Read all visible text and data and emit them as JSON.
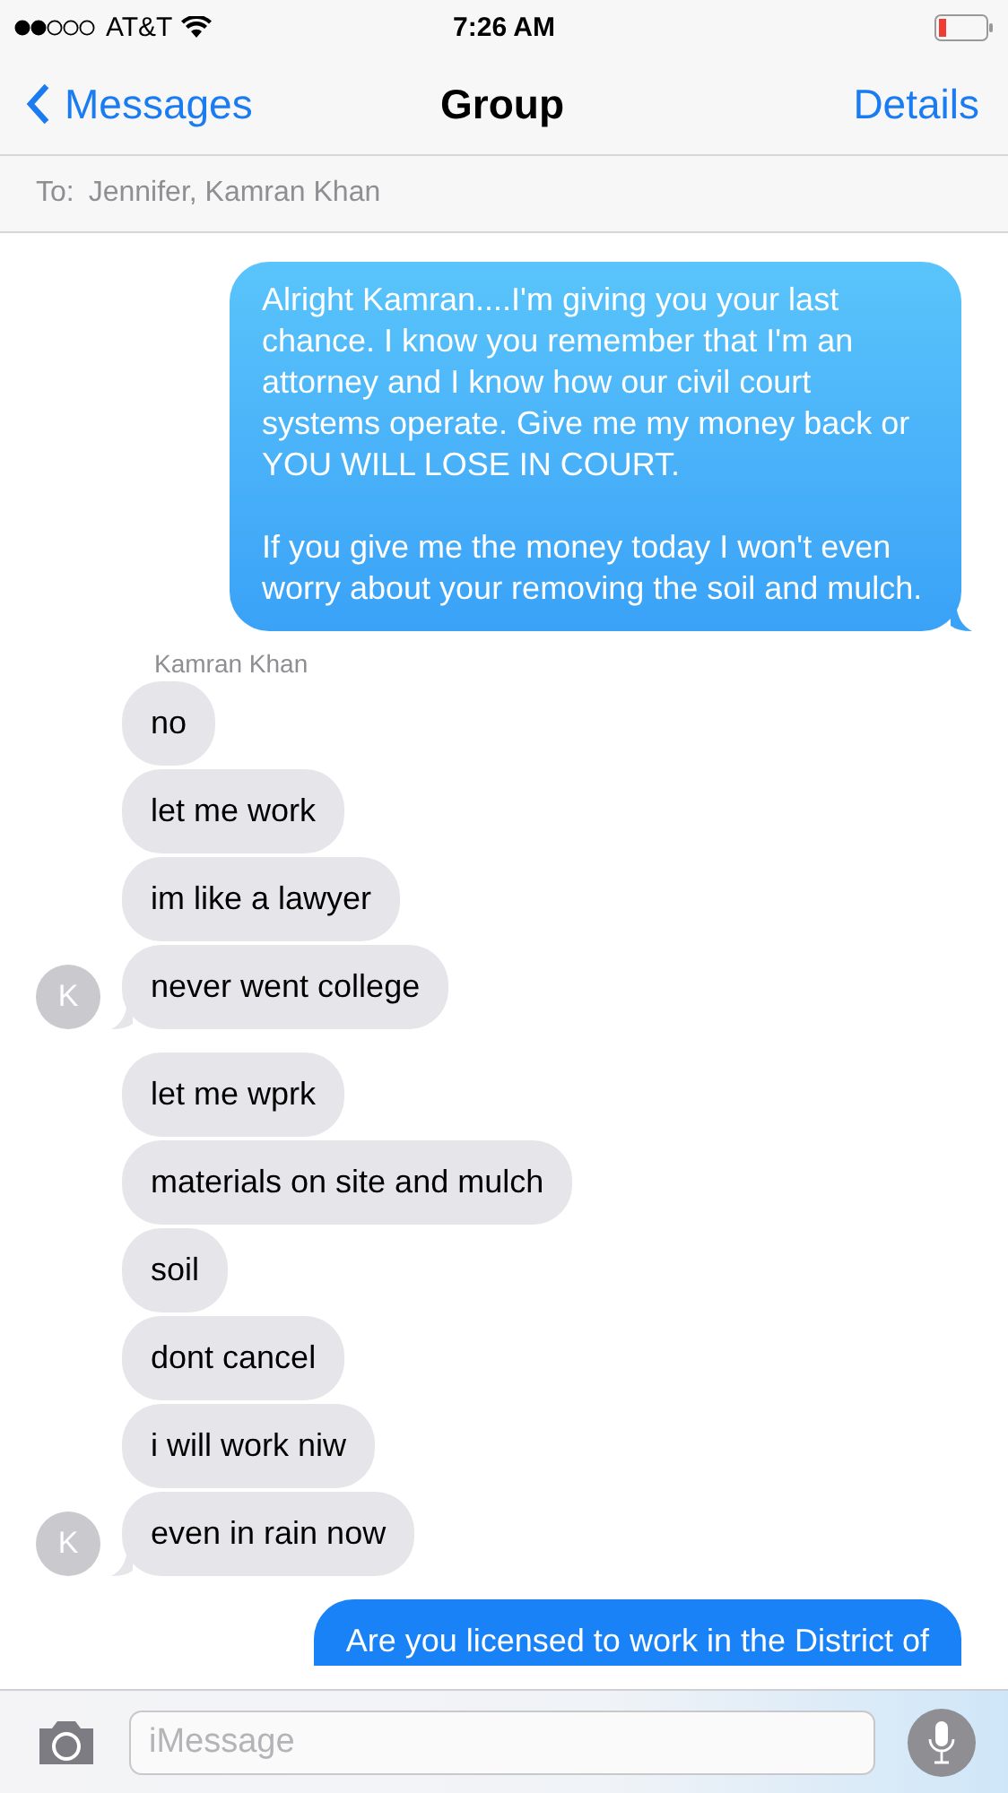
{
  "status_bar": {
    "carrier": "AT&T",
    "time": "7:26 AM"
  },
  "nav": {
    "back": "Messages",
    "title": "Group",
    "action": "Details"
  },
  "recipients": {
    "label": "To:",
    "names": "Jennifer, Kamran Khan"
  },
  "conversation": [
    {
      "kind": "outgoing",
      "paragraphs": [
        "Alright Kamran....I'm giving you your last chance. I know you remember that I'm an attorney and I know how our civil court systems operate. Give me my money back or YOU WILL LOSE IN COURT.",
        "If you give me the money today I won't even worry about your removing the soil and mulch."
      ]
    },
    {
      "kind": "sender",
      "text": "Kamran Khan"
    },
    {
      "kind": "incoming",
      "text": "no"
    },
    {
      "kind": "incoming",
      "text": "let me work"
    },
    {
      "kind": "incoming",
      "text": "im like a lawyer"
    },
    {
      "kind": "incoming",
      "text": "never went college",
      "avatar": "K"
    },
    {
      "kind": "incoming",
      "text": "let me wprk"
    },
    {
      "kind": "incoming",
      "text": "materials on site and mulch"
    },
    {
      "kind": "incoming",
      "text": "soil"
    },
    {
      "kind": "incoming",
      "text": "dont cancel"
    },
    {
      "kind": "incoming",
      "text": "i will work niw"
    },
    {
      "kind": "incoming",
      "text": "even in rain now",
      "avatar": "K"
    },
    {
      "kind": "outgoing",
      "paragraphs": [
        "Are you licensed to work in the District of"
      ]
    }
  ],
  "composer": {
    "placeholder": "iMessage"
  }
}
